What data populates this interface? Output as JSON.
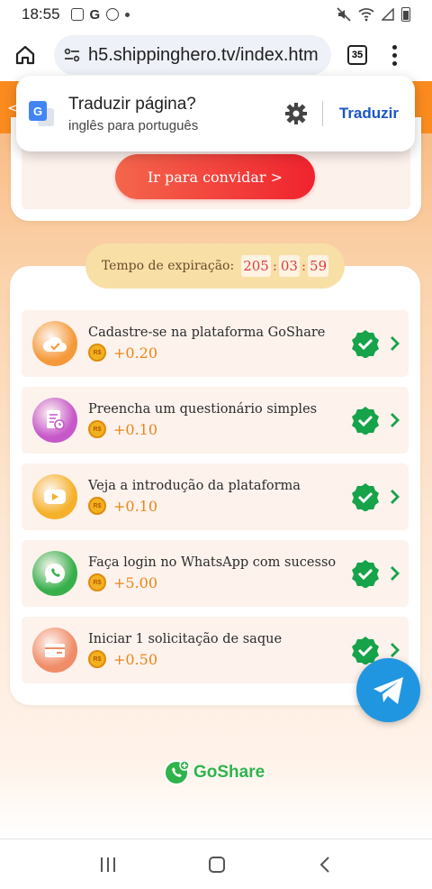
{
  "status_bar": {
    "time": "18:55"
  },
  "browser": {
    "url": "h5.shippinghero.tv/index.htm",
    "tab_count": "35"
  },
  "translate_popup": {
    "title": "Traduzir página?",
    "subtitle": "inglês para português",
    "button": "Traduzir"
  },
  "invite": {
    "button_label": "Ir para convidar >"
  },
  "expiry": {
    "label": "Tempo de expiração:",
    "hours": "205",
    "minutes": "03",
    "seconds": "59"
  },
  "tasks": [
    {
      "title": "Cadastre-se na plataforma GoShare",
      "reward": "+0.20",
      "icon": "cloud-check-icon",
      "color": "#f59a3a"
    },
    {
      "title": "Preencha um questionário simples",
      "reward": "+0.10",
      "icon": "questionnaire-icon",
      "color": "#c658c9"
    },
    {
      "title": "Veja a introdução da plataforma",
      "reward": "+0.10",
      "icon": "video-play-icon",
      "color": "#f6b12a"
    },
    {
      "title": "Faça login no WhatsApp com sucesso",
      "reward": "+5.00",
      "icon": "whatsapp-icon",
      "color": "#37b04c"
    },
    {
      "title": "Iniciar 1 solicitação de saque",
      "reward": "+0.50",
      "icon": "card-icon",
      "color": "#f08c68"
    }
  ],
  "coin_label": "R$",
  "brand": {
    "name": "GoShare"
  }
}
